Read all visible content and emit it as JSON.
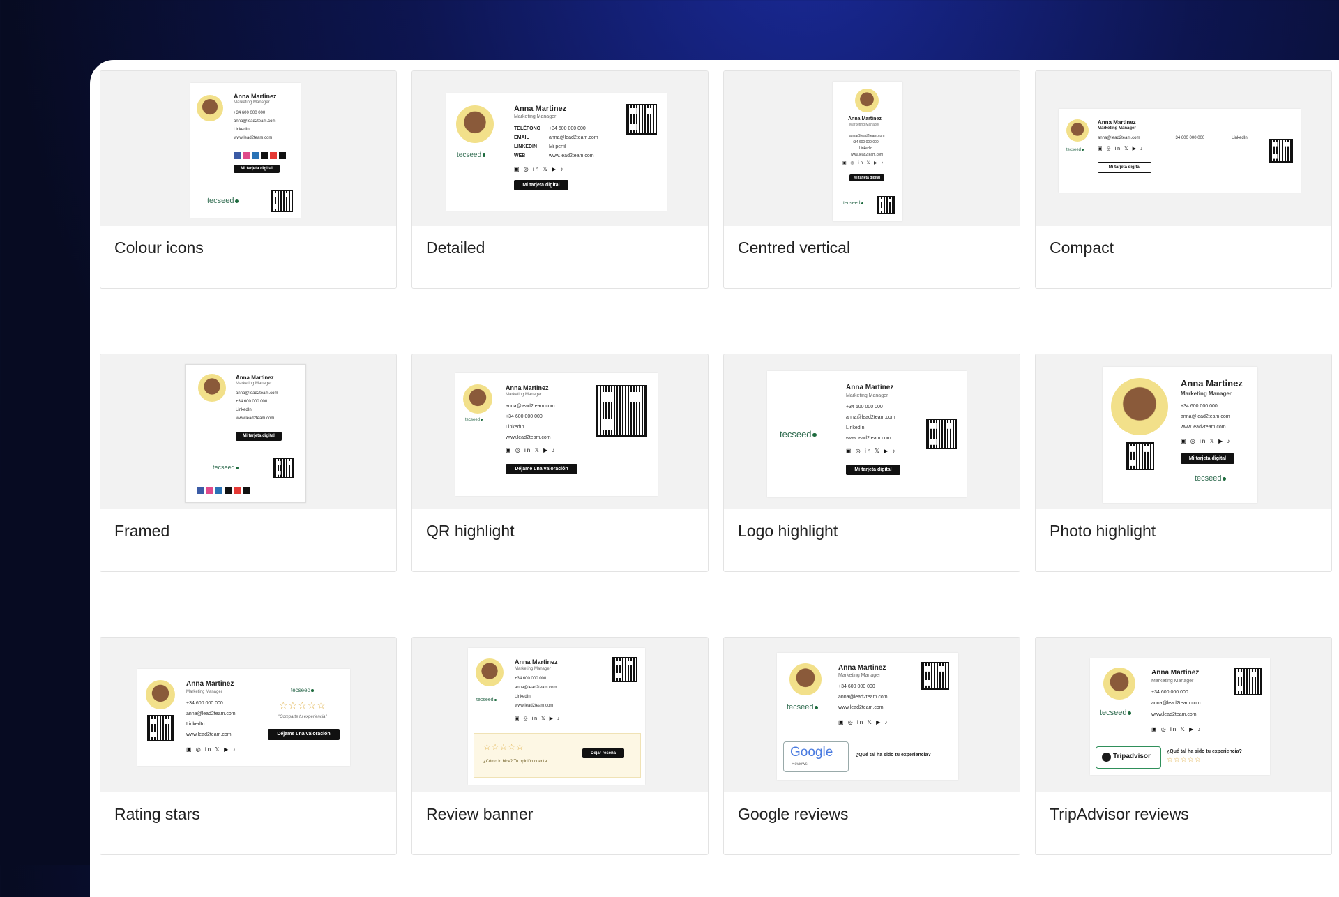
{
  "cards": [
    {
      "label": "Colour icons"
    },
    {
      "label": "Detailed"
    },
    {
      "label": "Centred vertical"
    },
    {
      "label": "Compact"
    },
    {
      "label": "Framed"
    },
    {
      "label": "QR highlight"
    },
    {
      "label": "Logo highlight"
    },
    {
      "label": "Photo highlight"
    },
    {
      "label": "Rating stars"
    },
    {
      "label": "Review banner"
    },
    {
      "label": "Google reviews"
    },
    {
      "label": "TripAdvisor reviews"
    }
  ],
  "signature": {
    "name": "Anna Martinez",
    "role": "Marketing Manager",
    "phone": "+34 600 000 000",
    "email": "anna@lead2team.com",
    "linkedin": "LinkedIn",
    "web": "www.lead2team.com",
    "company": "tecseed",
    "digital_card_button": "Mi tarjeta digital",
    "review_button": "Déjame una valoración",
    "review_link_button": "Dejar reseña",
    "share_experience": "\"Comparte tu experiencia\"",
    "how_did_we_do": "¿Cómo lo hice? Tu opinión cuenta.",
    "how_was_experience": "¿Qué tal ha sido tu experiencia?",
    "google_logo": "Google",
    "google_reviews": "Reviews",
    "tripadvisor_logo": "Tripadvisor",
    "detailed_labels": {
      "phone": "TELÉFONO",
      "email": "EMAIL",
      "linkedin": "LINKEDIN",
      "web": "WEB",
      "profile": "Mi perfil"
    },
    "social_icons": "▣ ◎ in 𝕏 ▶ ♪",
    "stars": "☆☆☆☆☆"
  }
}
